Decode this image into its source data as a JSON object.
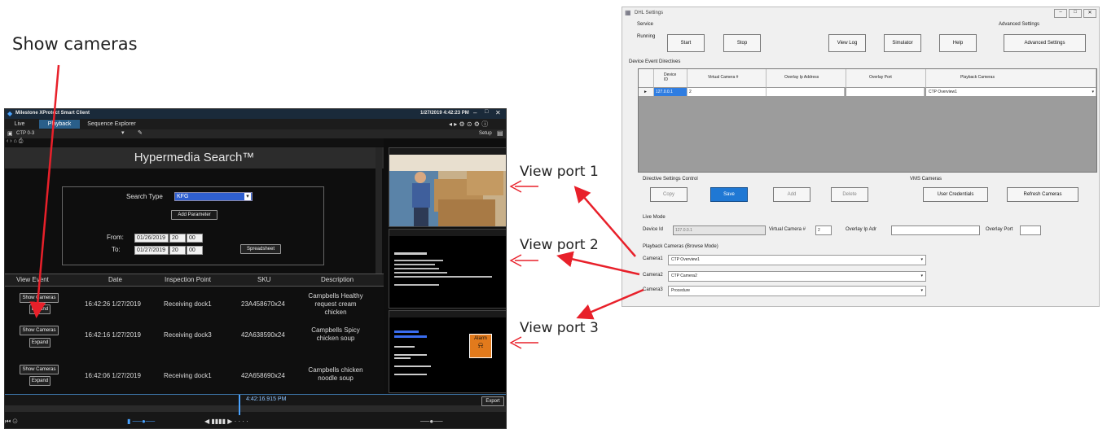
{
  "annotations": {
    "show_cameras": "Show cameras",
    "view_port_1": "View port 1",
    "view_port_2": "View port 2",
    "view_port_3": "View port 3",
    "arrow_color": "#e8202a"
  },
  "milestone": {
    "title": "Milestone XProtect Smart Client",
    "datetime": "1/27/2019 4:42:23 PM",
    "tabs": [
      "Live",
      "Playback",
      "Sequence Explorer"
    ],
    "camera_select": "CTP 0-3",
    "setup_label": "Setup",
    "panel_title": "Hypermedia Search™",
    "search_type_label": "Search Type",
    "search_type_value": "KFG",
    "add_parameter": "Add Parameter",
    "from_label": "From:",
    "to_label": "To:",
    "from_date": "01/26/2019",
    "to_date": "01/27/2019",
    "from_hour": "20",
    "from_min": "00",
    "to_hour": "20",
    "to_min": "00",
    "spreadsheet": "Spreadsheet",
    "columns": [
      "View Event",
      "Date",
      "Inspection Point",
      "SKU",
      "Description"
    ],
    "rows": [
      {
        "date": "16:42:26 1/27/2019",
        "point": "Receiving dock1",
        "sku": "23A458670x24",
        "desc": "Campbells Healthy request cream chicken"
      },
      {
        "date": "16:42:16 1/27/2019",
        "point": "Receiving dock3",
        "sku": "42A638590x24",
        "desc": "Campbells Spicy chicken soup"
      },
      {
        "date": "16:42:06 1/27/2019",
        "point": "Receiving dock1",
        "sku": "42A658690x24",
        "desc": "Campbells chicken noodle soup"
      }
    ],
    "show_cameras_btn": "Show Cameras",
    "expand_btn": "Expand",
    "alarm_label": "Alarm",
    "timeline_time": "4:42:16.915 PM",
    "export_btn": "Export"
  },
  "dhl": {
    "title": "DHL Settings",
    "service_label": "Service",
    "running_label": "Running",
    "advanced_label": "Advanced Settings",
    "buttons": {
      "start": "Start",
      "stop": "Stop",
      "view_log": "View Log",
      "simulator": "Simulator",
      "help": "Help",
      "advanced": "Advanced Settings"
    },
    "directives_label": "Device Event Directives",
    "grid_headers": [
      "Device ID",
      "Virtual Camera #",
      "Overlay Ip Address",
      "Overlay Port",
      "Playback Cameras"
    ],
    "grid_row": {
      "device": "127.0.0.1",
      "vcam": "2",
      "ip": "",
      "port": "",
      "playback": "CTP Overview1"
    },
    "directive_control_label": "Directive Settings Control",
    "vms_label": "VMS Cameras",
    "ctrl_buttons": {
      "copy": "Copy",
      "save": "Save",
      "add": "Add",
      "delete": "Delete",
      "user_credentials": "User Credentials",
      "refresh": "Refresh Cameras"
    },
    "live_mode_label": "Live Mode",
    "device_id_label": "Device Id",
    "device_id_value": "127.0.0.1",
    "vcam_label": "Virtual Camera #",
    "vcam_value": "2",
    "overlay_ip_label": "Overlay Ip Adr",
    "overlay_port_label": "Overlay Port",
    "playback_label": "Playback Cameras (Browse Mode)",
    "cameras": [
      {
        "label": "Camera1",
        "value": "CTP Overview1"
      },
      {
        "label": "Camera2",
        "value": "CTP Camera2"
      },
      {
        "label": "Camera3",
        "value": "Procedure"
      }
    ]
  }
}
